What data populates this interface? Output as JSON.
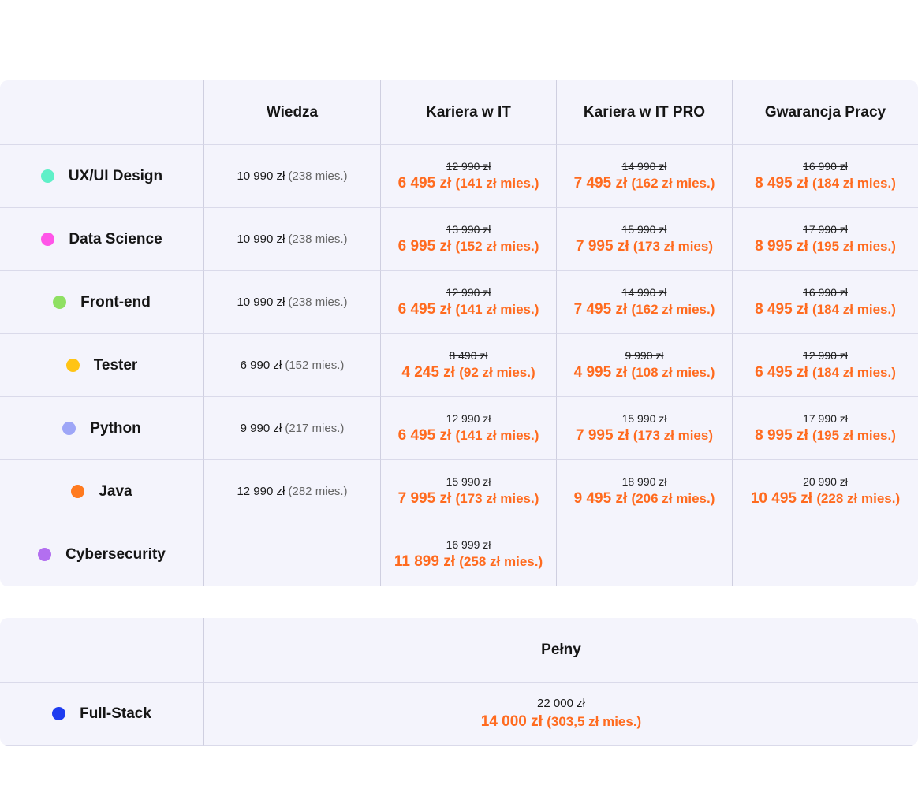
{
  "table1": {
    "headers": [
      "Wiedza",
      "Kariera w IT",
      "Kariera w IT PRO",
      "Gwarancja Pracy"
    ],
    "rows": [
      {
        "course": "UX/UI Design",
        "color": "#5ff0c8",
        "wiedza": {
          "price": "10 990 zł",
          "monthly": "(238 mies.)"
        },
        "prices": [
          {
            "old": "12 990 zł",
            "new": "6 495 zł",
            "monthly": "(141 zł mies.)"
          },
          {
            "old": "14 990 zł",
            "new": "7 495 zł",
            "monthly": "(162 zł mies.)"
          },
          {
            "old": "16 990 zł",
            "new": "8 495 zł",
            "monthly": "(184 zł mies.)"
          }
        ]
      },
      {
        "course": "Data Science",
        "color": "#ff55e8",
        "wiedza": {
          "price": "10 990 zł",
          "monthly": "(238 mies.)"
        },
        "prices": [
          {
            "old": "13 990 zł",
            "new": "6 995 zł",
            "monthly": "(152 zł mies.)"
          },
          {
            "old": "15 990 zł",
            "new": "7 995 zł",
            "monthly": "(173 zł mies)"
          },
          {
            "old": "17 990 zł",
            "new": "8 995 zł",
            "monthly": "(195 zł mies.)"
          }
        ]
      },
      {
        "course": "Front-end",
        "color": "#8fe063",
        "wiedza": {
          "price": "10 990 zł",
          "monthly": "(238 mies.)"
        },
        "prices": [
          {
            "old": "12 990 zł",
            "new": "6 495 zł",
            "monthly": "(141 zł mies.)"
          },
          {
            "old": "14 990 zł",
            "new": "7 495 zł",
            "monthly": "(162 zł mies.)"
          },
          {
            "old": "16 990 zł",
            "new": "8 495 zł",
            "monthly": "(184 zł mies.)"
          }
        ]
      },
      {
        "course": "Tester",
        "color": "#ffc414",
        "wiedza": {
          "price": "6 990 zł",
          "monthly": "(152 mies.)"
        },
        "prices": [
          {
            "old": "8 490 zł",
            "new": "4 245 zł",
            "monthly": "(92 zł mies.)"
          },
          {
            "old": "9 990 zł",
            "new": "4 995 zł",
            "monthly": "(108 zł mies.)"
          },
          {
            "old": "12 990 zł",
            "new": "6 495 zł",
            "monthly": "(184 zł mies.)"
          }
        ]
      },
      {
        "course": "Python",
        "color": "#9ea6f7",
        "wiedza": {
          "price": "9 990 zł",
          "monthly": "(217 mies.)"
        },
        "prices": [
          {
            "old": "12 990 zł",
            "new": "6 495 zł",
            "monthly": "(141 zł mies.)"
          },
          {
            "old": "15 990 zł",
            "new": "7 995 zł",
            "monthly": "(173 zł mies)"
          },
          {
            "old": "17 990 zł",
            "new": "8 995 zł",
            "monthly": "(195 zł mies.)"
          }
        ]
      },
      {
        "course": "Java",
        "color": "#ff7a1f",
        "wiedza": {
          "price": "12 990 zł",
          "monthly": "(282 mies.)"
        },
        "prices": [
          {
            "old": "15 990 zł",
            "new": "7 995 zł",
            "monthly": "(173 zł mies.)"
          },
          {
            "old": "18 990 zł",
            "new": "9 495 zł",
            "monthly": "(206 zł mies.)"
          },
          {
            "old": "20 990 zł",
            "new": "10 495 zł",
            "monthly": "(228 zł mies.)"
          }
        ]
      },
      {
        "course": "Cybersecurity",
        "color": "#b36ff0",
        "wiedza": null,
        "prices": [
          {
            "old": "16 999 zł",
            "new": "11 899 zł",
            "monthly": "(258 zł mies.)"
          },
          null,
          null
        ]
      }
    ]
  },
  "table2": {
    "headers": [
      "Pełny"
    ],
    "rows": [
      {
        "course": "Full-Stack",
        "color": "#1e3cf0",
        "price": "22 000 zł",
        "new": "14 000 zł",
        "monthly": "(303,5 zł mies.)"
      }
    ]
  }
}
